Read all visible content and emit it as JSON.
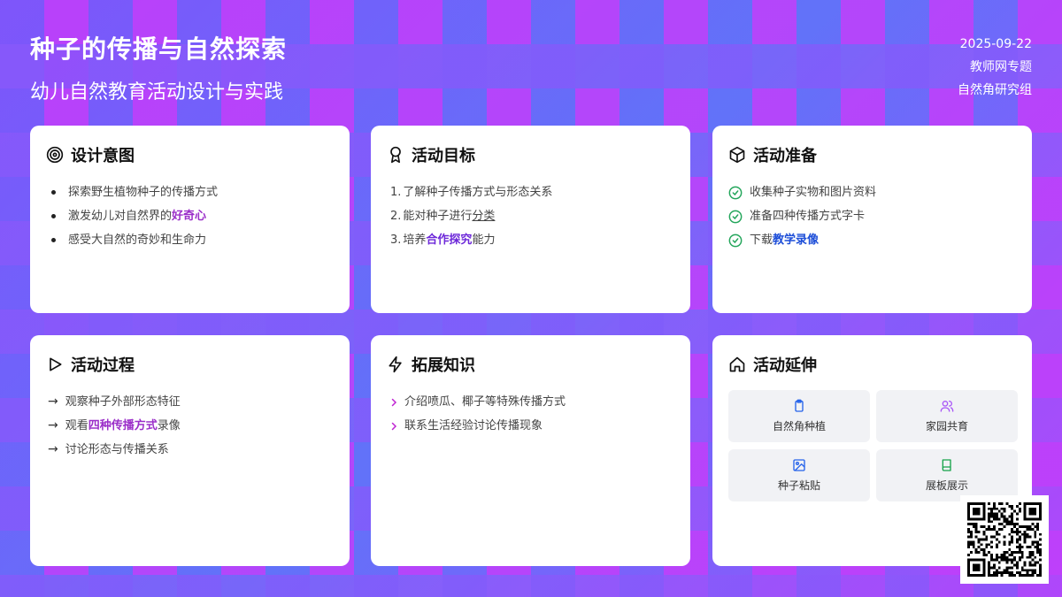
{
  "header": {
    "title": "种子的传播与自然探索",
    "subtitle": "幼儿自然教育活动设计与实践"
  },
  "meta": {
    "date": "2025-09-22",
    "source": "教师网专题",
    "group": "自然角研究组"
  },
  "cards": {
    "intent": {
      "title": "设计意图",
      "icon": "target-icon",
      "items": [
        {
          "text": "探索野生植物种子的传播方式"
        },
        {
          "pre": "激发幼儿对自然界的",
          "hl": "好奇心"
        },
        {
          "text": "感受大自然的奇妙和生命力"
        }
      ]
    },
    "goals": {
      "title": "活动目标",
      "icon": "award-icon",
      "items": [
        {
          "num": "1.",
          "text": "了解种子传播方式与形态关系"
        },
        {
          "num": "2.",
          "pre": "能对种子进行",
          "ul": "分类"
        },
        {
          "num": "3.",
          "pre": "培养",
          "hl": "合作探究",
          "post": "能力"
        }
      ]
    },
    "prep": {
      "title": "活动准备",
      "icon": "box-icon",
      "items": [
        {
          "text": "收集种子实物和图片资料"
        },
        {
          "text": "准备四种传播方式字卡"
        },
        {
          "pre": "下载",
          "hl": "教学录像"
        }
      ]
    },
    "process": {
      "title": "活动过程",
      "icon": "play-icon",
      "items": [
        {
          "text": "观察种子外部形态特征"
        },
        {
          "pre": "观看",
          "hl": "四种传播方式",
          "post": "录像"
        },
        {
          "text": "讨论形态与传播关系"
        }
      ]
    },
    "extend_knowledge": {
      "title": "拓展知识",
      "icon": "lightning-icon",
      "items": [
        {
          "text": "介绍喷瓜、椰子等特殊传播方式"
        },
        {
          "text": "联系生活经验讨论传播现象"
        }
      ]
    },
    "extension": {
      "title": "活动延伸",
      "icon": "home-icon",
      "tiles": [
        {
          "label": "自然角种植",
          "icon": "clipboard-icon"
        },
        {
          "label": "家园共育",
          "icon": "users-icon"
        },
        {
          "label": "种子粘贴",
          "icon": "image-icon"
        },
        {
          "label": "展板展示",
          "icon": "book-icon"
        }
      ]
    }
  },
  "colors": {
    "highlight_purple": "#9b2fc9",
    "highlight_blue": "#1d4ed8",
    "highlight_violet": "#6d28d9",
    "check_green": "#22a55a",
    "chevron_pink": "#c026d3"
  }
}
